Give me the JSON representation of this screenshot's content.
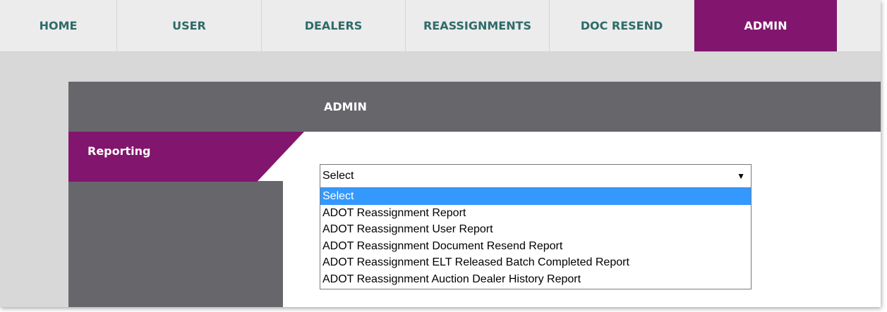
{
  "nav": {
    "tabs": [
      {
        "label": "HOME",
        "active": false
      },
      {
        "label": "USER",
        "active": false
      },
      {
        "label": "DEALERS",
        "active": false
      },
      {
        "label": "REASSIGNMENTS",
        "active": false
      },
      {
        "label": "DOC RESEND",
        "active": false
      },
      {
        "label": "ADMIN",
        "active": true
      }
    ]
  },
  "panel": {
    "title": "ADMIN",
    "section_label": "Reporting"
  },
  "report_select": {
    "selected_value": "Select",
    "options": [
      "Select",
      "ADOT Reassignment Report",
      "ADOT Reassignment User Report",
      "ADOT Reassignment Document Resend Report",
      "ADOT Reassignment ELT Released Batch Completed Report",
      "ADOT Reassignment Auction Dealer History Report"
    ],
    "highlighted_index": 0
  },
  "colors": {
    "accent_purple": "#82166e",
    "nav_text_teal": "#2e6b69",
    "panel_gray": "#67676b",
    "option_highlight": "#3399ff"
  },
  "icons": {
    "dropdown_arrow": "triangle-down-icon"
  }
}
